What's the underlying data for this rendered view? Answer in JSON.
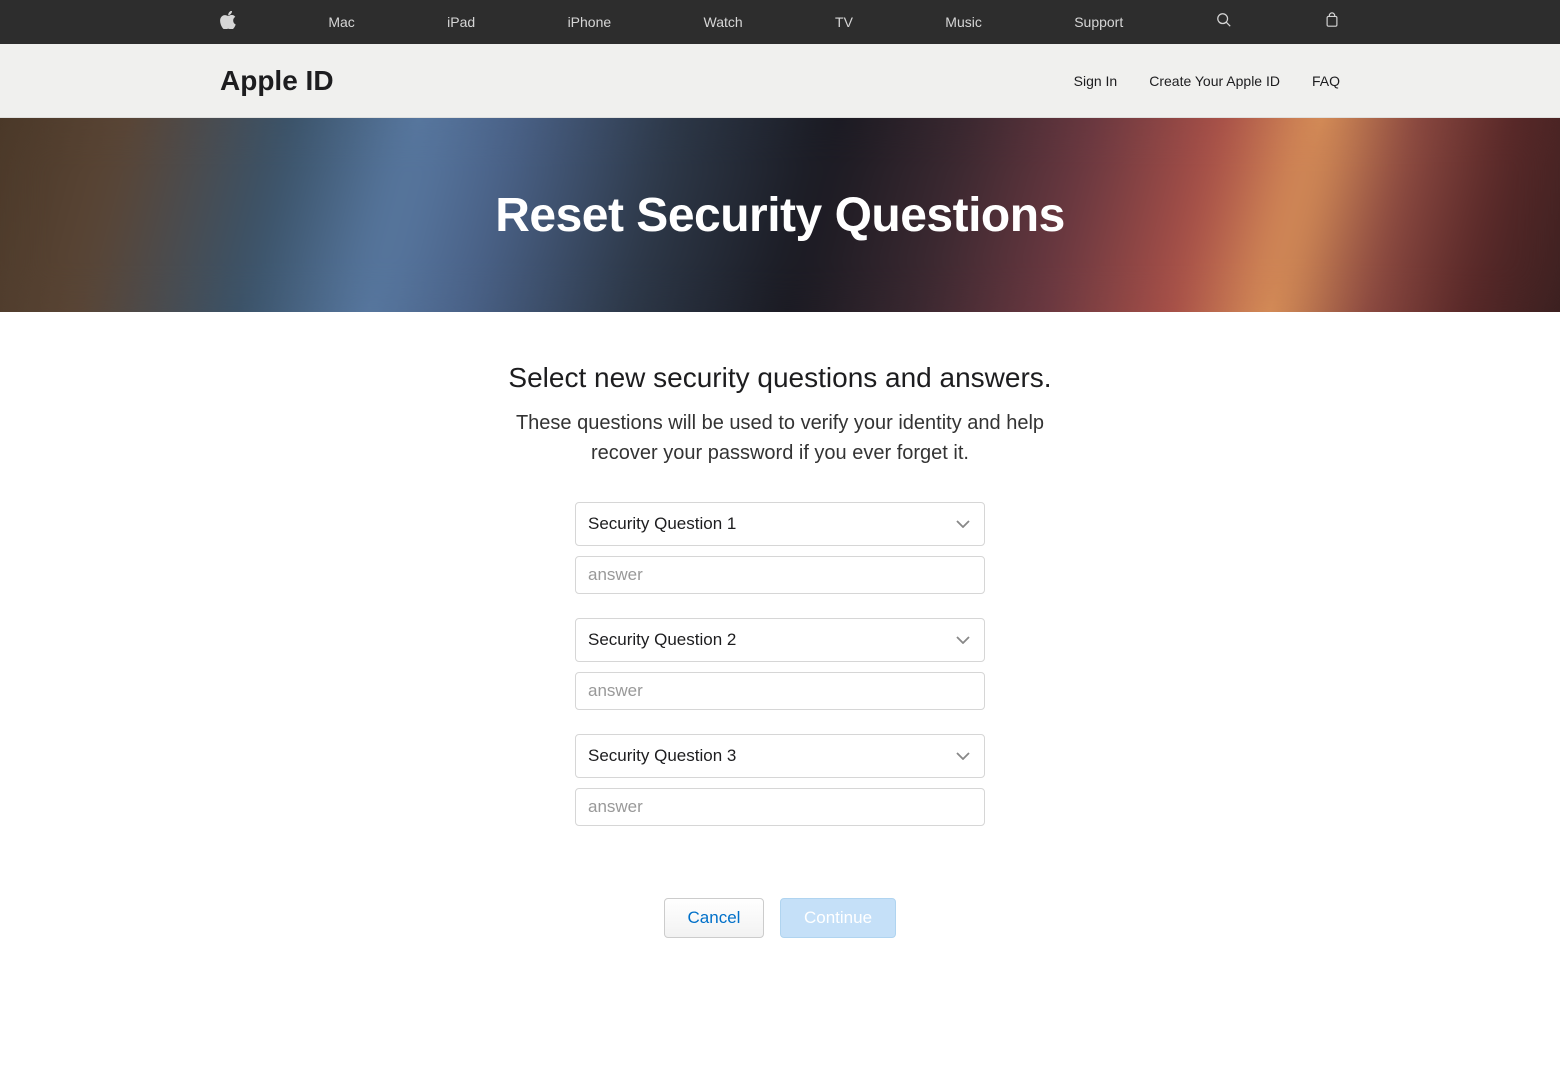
{
  "global_nav": {
    "items": [
      "Mac",
      "iPad",
      "iPhone",
      "Watch",
      "TV",
      "Music",
      "Support"
    ]
  },
  "sub_nav": {
    "brand": "Apple ID",
    "links": [
      "Sign In",
      "Create Your Apple ID",
      "FAQ"
    ]
  },
  "hero": {
    "title": "Reset Security Questions"
  },
  "content": {
    "heading": "Select new security questions and answers.",
    "sub": "These questions will be used to verify your identity and help recover your password if you ever forget it."
  },
  "form": {
    "questions": [
      {
        "label": "Security Question 1",
        "placeholder": "answer"
      },
      {
        "label": "Security Question 2",
        "placeholder": "answer"
      },
      {
        "label": "Security Question 3",
        "placeholder": "answer"
      }
    ],
    "cancel": "Cancel",
    "continue": "Continue"
  }
}
